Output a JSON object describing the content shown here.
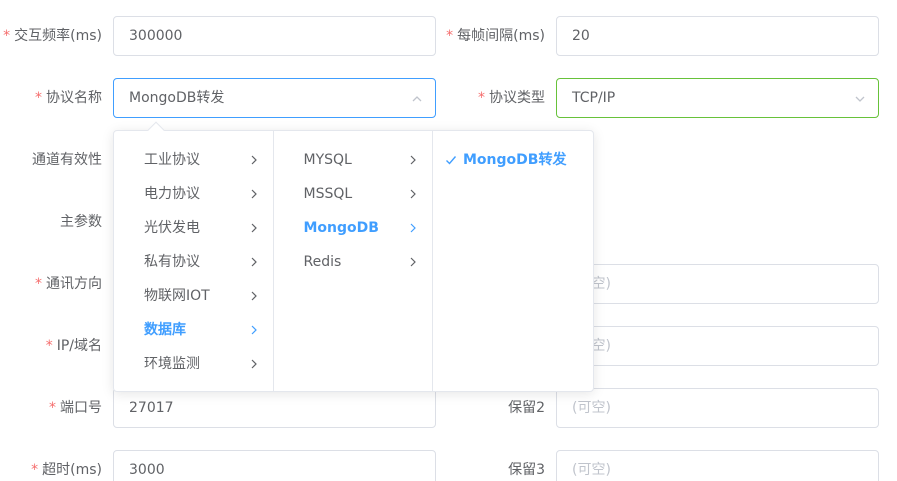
{
  "form": {
    "interaction_freq": {
      "label": "交互频率(ms)",
      "value": "300000"
    },
    "frame_interval": {
      "label": "每帧间隔(ms)",
      "value": "20"
    },
    "protocol_name": {
      "label": "协议名称",
      "value": "MongoDB转发"
    },
    "protocol_type": {
      "label": "协议类型",
      "value": "TCP/IP"
    },
    "channel_validity": {
      "label": "通道有效性"
    },
    "main_params": {
      "label": "主参数"
    },
    "comm_direction": {
      "label": "通讯方向"
    },
    "ip_domain": {
      "label": "IP/域名"
    },
    "port": {
      "label": "端口号",
      "value": "27017"
    },
    "timeout": {
      "label": "超时(ms)",
      "value": "3000"
    },
    "reserve1": {
      "placeholder_partial": "(可空)"
    },
    "reserve_mid": {
      "placeholder_partial": "(可空)"
    },
    "reserve2": {
      "label": "保留2",
      "placeholder": "(可空)"
    },
    "reserve3": {
      "label": "保留3",
      "placeholder": "(可空)"
    },
    "required_mark": "*"
  },
  "cascader": {
    "level1": [
      {
        "label": "工业协议"
      },
      {
        "label": "电力协议"
      },
      {
        "label": "光伏发电"
      },
      {
        "label": "私有协议"
      },
      {
        "label": "物联网IOT"
      },
      {
        "label": "数据库"
      },
      {
        "label": "环境监测"
      }
    ],
    "level2": [
      {
        "label": "MYSQL"
      },
      {
        "label": "MSSQL"
      },
      {
        "label": "MongoDB"
      },
      {
        "label": "Redis"
      }
    ],
    "level3": [
      {
        "label": "MongoDB转发"
      }
    ],
    "active": {
      "level1": "数据库",
      "level2": "MongoDB",
      "level3": "MongoDB转发"
    }
  },
  "colors": {
    "active": "#409eff",
    "required": "#f56c6c",
    "focus_green": "#67c23a"
  },
  "icons": {
    "select_arrow": "chevron-down-icon",
    "select_arrow_open": "chevron-up-icon",
    "submenu": "chevron-right-icon",
    "selected": "check-icon"
  }
}
